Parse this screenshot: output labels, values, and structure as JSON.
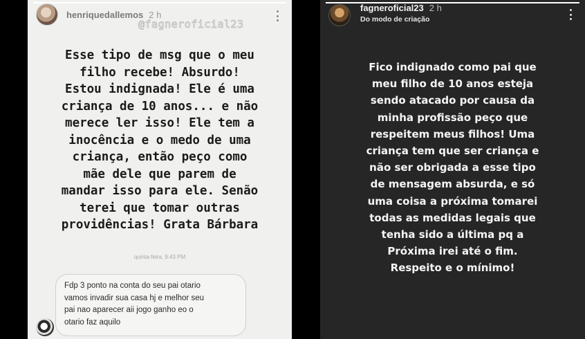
{
  "left_story": {
    "username": "henriquedallemos",
    "time": "2 h",
    "mention": "@fagneroficial23",
    "progress": 1.0,
    "text_lines": [
      "Esse tipo de msg que o meu",
      "filho recebe! Absurdo!",
      "Estou indignada! Ele é uma",
      "criança de 10 anos... e não",
      "merece ler isso! Ele tem a",
      "inocência e o medo de uma",
      "criança, então peço como",
      "mãe dele que parem de",
      "mandar isso para ele. Senão",
      "terei que tomar outras",
      "providências! Grata Bárbara"
    ],
    "message_time": "quinta-feira, 9:43 PM",
    "dm_lines": [
      "Fdp 3 ponto na conta do seu pai otario",
      "vamos invadir sua casa hj e  melhor seu",
      "pai nao aparecer aii jogo ganho eo o",
      "otario faz aquilo"
    ]
  },
  "right_story": {
    "username": "fagneroficial23",
    "time": "2 h",
    "subtitle": "Do modo de criação",
    "progress": 1.0,
    "text_lines": [
      "Fico indignado como pai que",
      "meu filho de 10 anos esteja",
      "sendo atacado por causa da",
      "minha profissão peço que",
      "respeitem meus filhos! Uma",
      "criança tem que ser criança e",
      "não ser obrigada a esse tipo",
      "de mensagem absurda, e só",
      "uma coisa a próxima tomarei",
      "todas as medidas legais que",
      "tenha sido a última pq a",
      "Próxima irei até o fim.",
      "Respeito e o mínimo!"
    ]
  }
}
